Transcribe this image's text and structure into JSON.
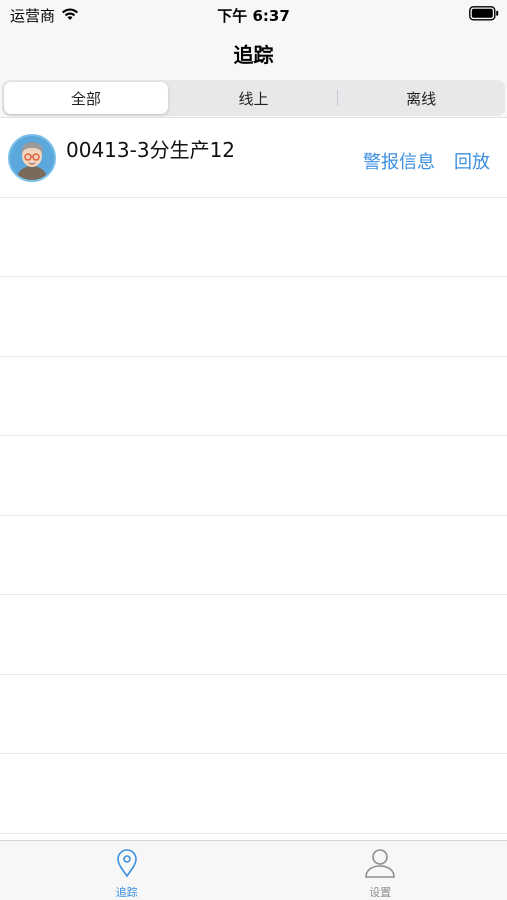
{
  "status_bar": {
    "carrier": "运营商",
    "time": "下午 6:37"
  },
  "nav": {
    "title": "追踪"
  },
  "segments": [
    {
      "label": "全部",
      "selected": true
    },
    {
      "label": "线上",
      "selected": false
    },
    {
      "label": "离线",
      "selected": false
    }
  ],
  "devices": [
    {
      "name": "00413-3分生产12",
      "avatar_icon": "person-avatar-icon",
      "actions": [
        "警报信息",
        "回放"
      ]
    }
  ],
  "tab_bar": {
    "items": [
      {
        "label": "追踪",
        "icon": "location-pin-icon",
        "active": true
      },
      {
        "label": "设置",
        "icon": "person-icon",
        "active": false
      }
    ]
  },
  "colors": {
    "accent": "#3a8fe0",
    "bar_background": "#f7f7f7",
    "inactive_tab": "#8e8e93"
  }
}
